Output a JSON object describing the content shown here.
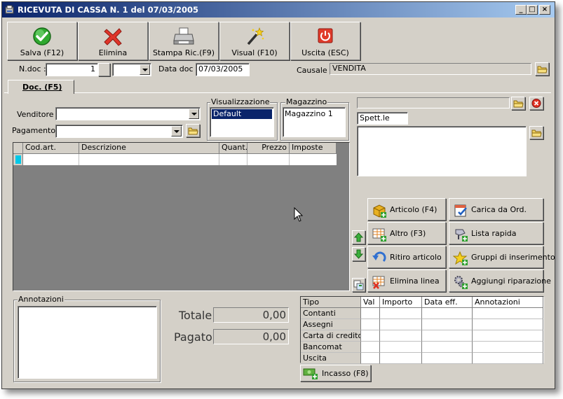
{
  "window": {
    "title": "RICEVUTA DI CASSA N. 1  del 07/03/2005",
    "controls": {
      "minimize": "_",
      "maximize": "□",
      "close": "×"
    }
  },
  "toolbar": {
    "save_label": "Salva (F12)",
    "delete_label": "Elimina",
    "print_label": "Stampa Ric.(F9)",
    "visual_label": "Visual (F10)",
    "exit_label": "Uscita (ESC)"
  },
  "header": {
    "ndoc_label": "N.doc :",
    "ndoc_value": "1",
    "ndoc_suffix": "",
    "data_label": "Data doc :",
    "data_value": "07/03/2005",
    "causale_label": "Causale :",
    "causale_value": "VENDITA"
  },
  "tab": {
    "label": "Doc. (F5)"
  },
  "form": {
    "venditore_label": "Venditore :",
    "venditore_value": "",
    "pagamento_label": "Pagamento :",
    "pagamento_value": "",
    "visualizzazione_caption": "Visualizzazione",
    "visualizzazione_items": [
      "Default"
    ],
    "magazzino_caption": "Magazzino",
    "magazzino_items": [
      "Magazzino 1"
    ]
  },
  "customer": {
    "code_value": "",
    "spett_value": "Spett.le",
    "address_value": ""
  },
  "grid": {
    "columns": [
      "Cod.art.",
      "Descrizione",
      "Quant.",
      "Prezzo",
      "Imposte"
    ],
    "rows": [
      [
        "",
        "",
        "",
        "",
        ""
      ]
    ]
  },
  "actions": {
    "articolo": "Articolo (F4)",
    "carica": "Carica da Ord.",
    "altro": "Altro (F3)",
    "lista": "Lista rapida",
    "ritiro": "Ritiro articolo",
    "gruppi": "Gruppi di inserimento",
    "elimina": "Elimina linea",
    "riparazione": "Aggiungi riparazione"
  },
  "annotations": {
    "caption": "Annotazioni",
    "value": ""
  },
  "totals": {
    "totale_label": "Totale",
    "totale_value": "0,00",
    "pagato_label": "Pagato",
    "pagato_value": "0,00"
  },
  "payments": {
    "columns": [
      "Tipo",
      "Val",
      "Importo",
      "Data eff.",
      "Annotazioni"
    ],
    "rows": [
      "Contanti",
      "Assegni",
      "Carta di credito",
      "Bancomat",
      "Uscita"
    ]
  },
  "incasso_label": "Incasso (F8)",
  "icons": {
    "save": "check-icon",
    "delete": "red-x-icon",
    "print": "printer-icon",
    "visual": "magic-wand-icon",
    "exit": "power-icon"
  }
}
